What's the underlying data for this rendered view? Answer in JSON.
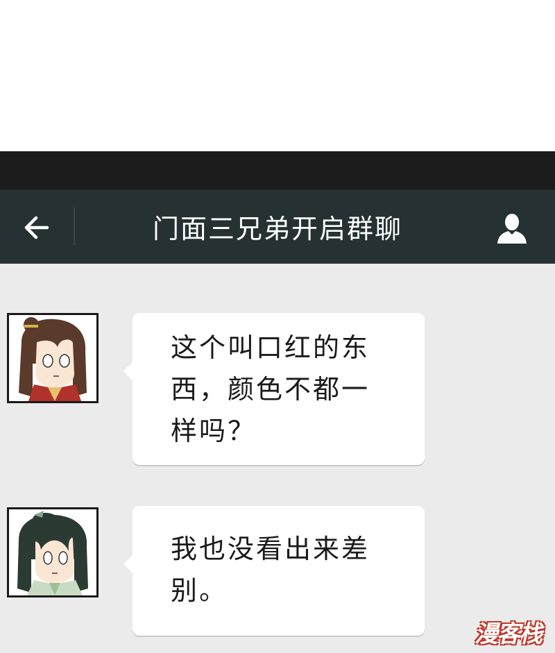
{
  "header": {
    "title": "门面三兄弟开启群聊",
    "back_icon": "arrow-left-icon",
    "contact_icon": "person-icon"
  },
  "messages": [
    {
      "sender_avatar": "avatar-long-brown-hair",
      "text": "这个叫口红的东\n西，颜色不都一\n样吗？"
    },
    {
      "sender_avatar": "avatar-long-dark-hair",
      "text": "我也没看出来差\n别。"
    }
  ],
  "watermark": {
    "text": "漫客栈"
  },
  "colors": {
    "nav_bg": "#253132",
    "status_bg": "#1c1c1c",
    "chat_bg": "#ebebeb",
    "bubble_bg": "#ffffff",
    "title_color": "#ffffff"
  }
}
